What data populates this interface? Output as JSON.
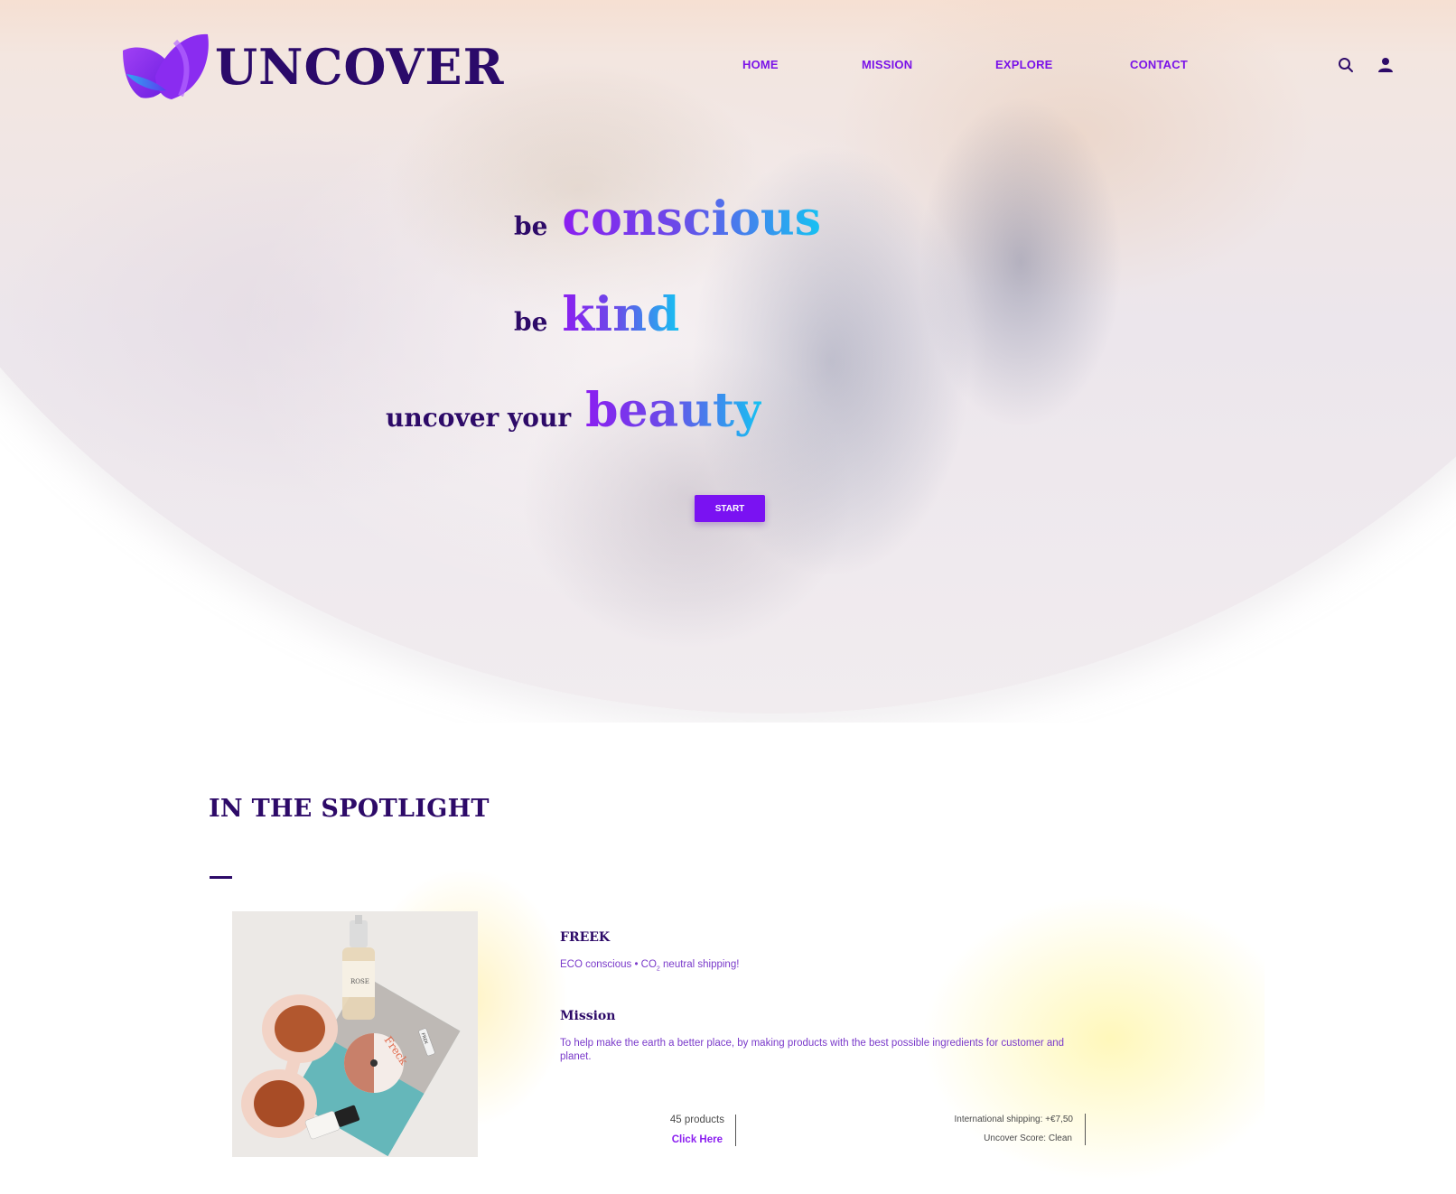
{
  "brand": {
    "logo_text": "UNCOVER"
  },
  "nav": {
    "items": [
      "HOME",
      "MISSION",
      "EXPLORE",
      "CONTACT"
    ]
  },
  "header_icons": [
    "search-icon",
    "user-icon"
  ],
  "hero": {
    "lines": [
      {
        "lead": "be",
        "word": "conscious"
      },
      {
        "lead": "be",
        "word": "kind"
      },
      {
        "lead": "uncover your",
        "word": "beauty"
      }
    ],
    "cta_label": "START"
  },
  "spotlight": {
    "title": "IN THE SPOTLIGHT",
    "brand_name": "FREEK",
    "tagline_before": "ECO conscious • CO",
    "tagline_sub": "2",
    "tagline_after": " neutral shipping!",
    "mission_title": "Mission",
    "mission_text": "To help make the earth a better place, by making products with the best possible ingredients for customer and planet.",
    "product_count": "45 products",
    "link_label": "Click Here",
    "shipping": "International shipping: +€7,50",
    "score": "Uncover Score: Clean",
    "product_labels": {
      "bottle": "ROSE",
      "disc": "Freck",
      "tube": "FREK"
    }
  },
  "colors": {
    "accent": "#7a12f2",
    "heading": "#2d0a68",
    "nav": "#7a12e8",
    "gradient_start": "#8b1ef0",
    "gradient_end": "#16c2f2"
  }
}
